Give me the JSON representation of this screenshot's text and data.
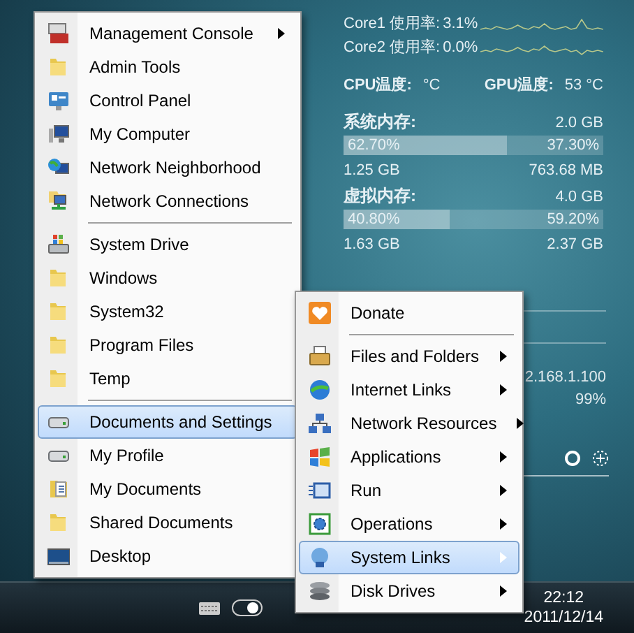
{
  "main_menu": {
    "items": [
      {
        "kind": "item",
        "label": "Management Console",
        "selected": false,
        "has_submenu": true
      },
      {
        "kind": "item",
        "label": "Admin Tools",
        "selected": false,
        "has_submenu": false
      },
      {
        "kind": "item",
        "label": "Control Panel",
        "selected": false,
        "has_submenu": false
      },
      {
        "kind": "item",
        "label": "My Computer",
        "selected": false,
        "has_submenu": false
      },
      {
        "kind": "item",
        "label": "Network Neighborhood",
        "selected": false,
        "has_submenu": false
      },
      {
        "kind": "item",
        "label": "Network Connections",
        "selected": false,
        "has_submenu": false
      },
      {
        "kind": "separator"
      },
      {
        "kind": "item",
        "label": "System Drive",
        "selected": false,
        "has_submenu": false
      },
      {
        "kind": "item",
        "label": "Windows",
        "selected": false,
        "has_submenu": false
      },
      {
        "kind": "item",
        "label": "System32",
        "selected": false,
        "has_submenu": false
      },
      {
        "kind": "item",
        "label": "Program Files",
        "selected": false,
        "has_submenu": false
      },
      {
        "kind": "item",
        "label": "Temp",
        "selected": false,
        "has_submenu": false
      },
      {
        "kind": "separator"
      },
      {
        "kind": "item",
        "label": "Documents and Settings",
        "selected": true,
        "has_submenu": false
      },
      {
        "kind": "item",
        "label": "My Profile",
        "selected": false,
        "has_submenu": false
      },
      {
        "kind": "item",
        "label": "My Documents",
        "selected": false,
        "has_submenu": false
      },
      {
        "kind": "item",
        "label": "Shared Documents",
        "selected": false,
        "has_submenu": false
      },
      {
        "kind": "item",
        "label": "Desktop",
        "selected": false,
        "has_submenu": false
      }
    ]
  },
  "sub_menu": {
    "items": [
      {
        "kind": "item",
        "label": "Donate",
        "selected": false,
        "has_submenu": false
      },
      {
        "kind": "separator"
      },
      {
        "kind": "item",
        "label": "Files and Folders",
        "selected": false,
        "has_submenu": true
      },
      {
        "kind": "item",
        "label": "Internet Links",
        "selected": false,
        "has_submenu": true
      },
      {
        "kind": "item",
        "label": "Network Resources",
        "selected": false,
        "has_submenu": true
      },
      {
        "kind": "item",
        "label": "Applications",
        "selected": false,
        "has_submenu": true
      },
      {
        "kind": "item",
        "label": "Run",
        "selected": false,
        "has_submenu": true
      },
      {
        "kind": "item",
        "label": "Operations",
        "selected": false,
        "has_submenu": true
      },
      {
        "kind": "item",
        "label": "System Links",
        "selected": true,
        "has_submenu": true
      },
      {
        "kind": "item",
        "label": "Disk Drives",
        "selected": false,
        "has_submenu": true
      }
    ]
  },
  "monitor": {
    "cores": [
      {
        "label": "Core1 使用率:",
        "value": "3.1%"
      },
      {
        "label": "Core2 使用率:",
        "value": "0.0%"
      }
    ],
    "temps": [
      {
        "label": "CPU温度:",
        "value": "°C"
      },
      {
        "label": "GPU温度:",
        "value": "53 °C"
      }
    ],
    "memory": [
      {
        "title": "系统内存:",
        "total": "2.0 GB",
        "used_pct": "62.70%",
        "free_pct": "37.30%",
        "level": 0.627,
        "used": "1.25 GB",
        "free": "763.68 MB"
      },
      {
        "title": "虚拟内存:",
        "total": "4.0 GB",
        "used_pct": "40.80%",
        "free_pct": "59.20%",
        "level": 0.408,
        "used": "1.63 GB",
        "free": "2.37 GB"
      }
    ],
    "ip": "2.168.1.100",
    "percent": "99%"
  },
  "taskbar": {
    "time": "22:12",
    "date": "2011/12/14"
  }
}
